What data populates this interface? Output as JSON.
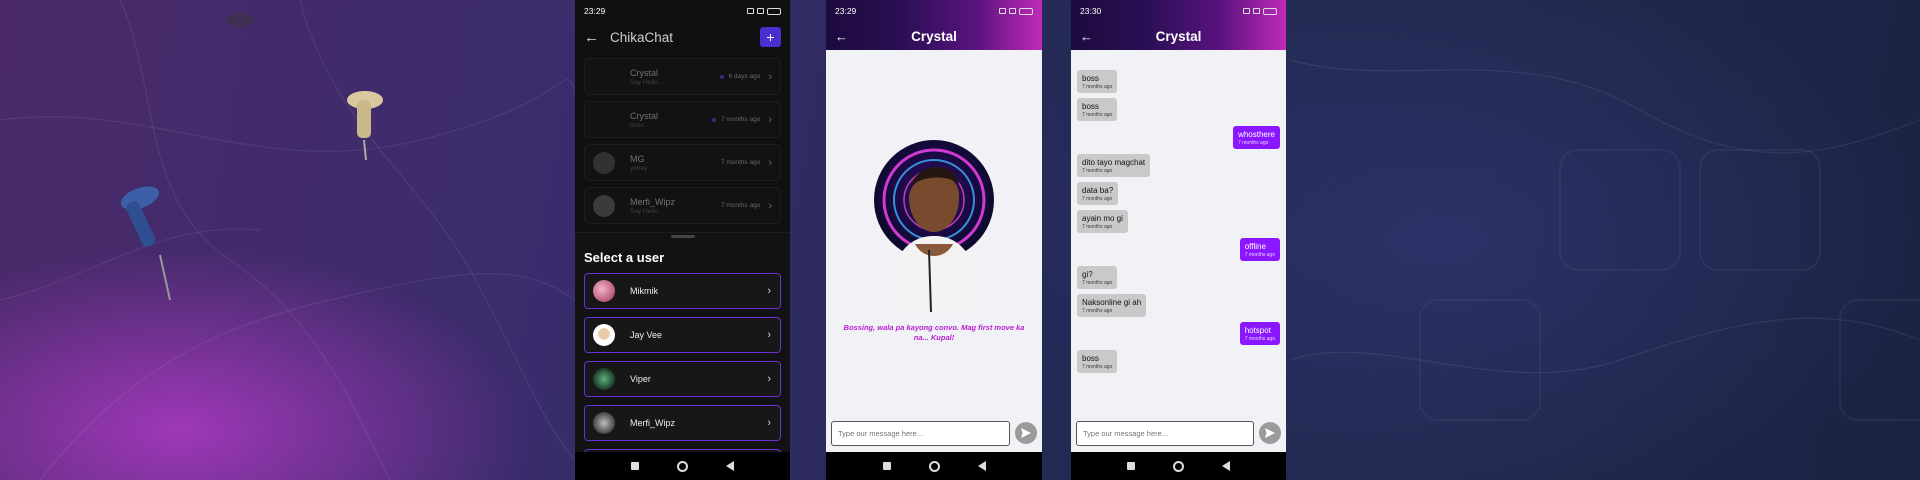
{
  "phone1": {
    "time": "23:29",
    "app_title": "ChikaChat",
    "new_chat_icon": "plus-icon",
    "conversations": [
      {
        "name": "Crystal",
        "preview": "Say Hello...",
        "time": "6 days ago",
        "unread": true
      },
      {
        "name": "Crystal",
        "preview": "boss",
        "time": "7 months ago",
        "unread": true
      },
      {
        "name": "MG",
        "preview": "yehey",
        "time": "7 months ago",
        "unread": false
      },
      {
        "name": "Merfi_Wipz",
        "preview": "Say Hello...",
        "time": "7 months ago",
        "unread": false
      }
    ],
    "sheet_title": "Select a user",
    "users": [
      {
        "name": "Mikmik"
      },
      {
        "name": "Jay Vee"
      },
      {
        "name": "Viper"
      },
      {
        "name": "Merfi_Wipz"
      }
    ]
  },
  "phone2": {
    "time": "23:29",
    "title": "Crystal",
    "empty_message": "Bossing, wala pa kayong convo. Mag first move ka na... Kupal!",
    "input_placeholder": "Type our message here..."
  },
  "phone3": {
    "time": "23:30",
    "title": "Crystal",
    "input_placeholder": "Type our message here...",
    "messages": [
      {
        "text": "boss",
        "time": "7 months ago",
        "dir": "in"
      },
      {
        "text": "boss",
        "time": "7 months ago",
        "dir": "in"
      },
      {
        "text": "whosthere",
        "time": "7 months ago",
        "dir": "out"
      },
      {
        "text": "dito tayo magchat",
        "time": "7 months ago",
        "dir": "in"
      },
      {
        "text": "data ba?",
        "time": "7 months ago",
        "dir": "in"
      },
      {
        "text": "ayain mo gi",
        "time": "7 months ago",
        "dir": "in"
      },
      {
        "text": "offline",
        "time": "7 months ago",
        "dir": "out"
      },
      {
        "text": "gi?",
        "time": "7 months ago",
        "dir": "in"
      },
      {
        "text": "Naksonline gi ah",
        "time": "7 months ago",
        "dir": "in"
      },
      {
        "text": "hotspot",
        "time": "7 months ago",
        "dir": "out"
      },
      {
        "text": "boss",
        "time": "7 months ago",
        "dir": "in"
      }
    ]
  },
  "colors": {
    "accent": "#6d2fd6",
    "send_bubble": "#8a17ff",
    "received_bubble": "#c9c9c9",
    "empty_text": "#b81fd2"
  }
}
